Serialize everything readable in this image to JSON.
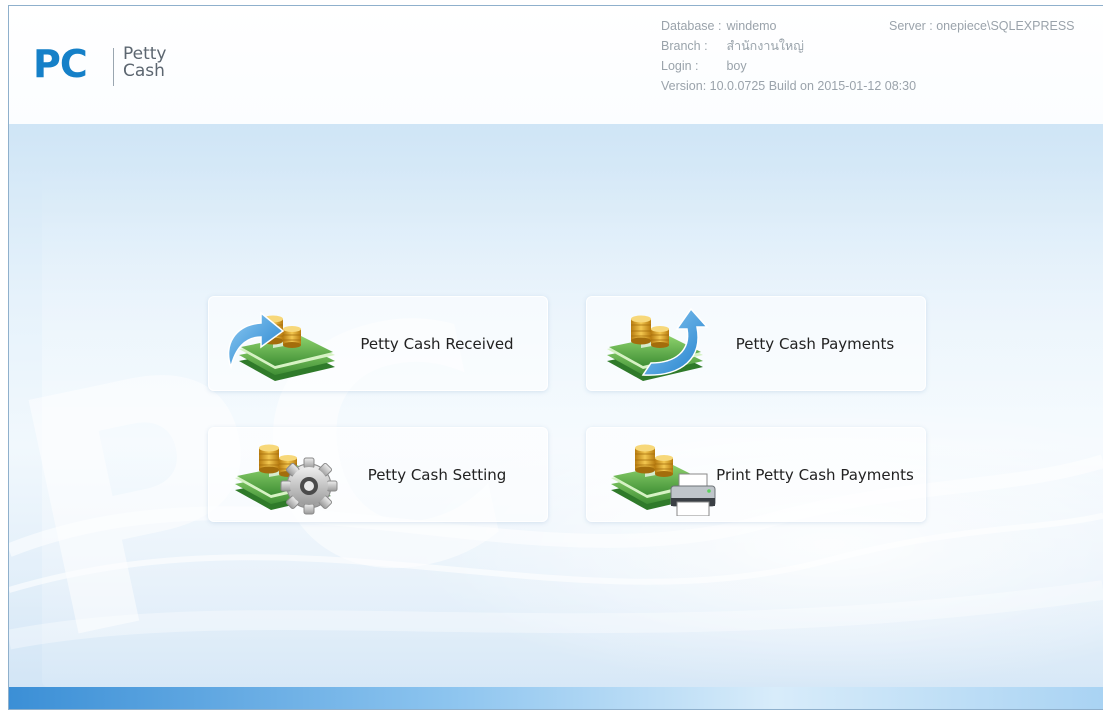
{
  "logo": {
    "mark": "PC",
    "line1": "Petty",
    "line2": "Cash"
  },
  "info": {
    "database_label": "Database :",
    "database_value": "windemo",
    "branch_label": "Branch :",
    "branch_value": "สำนักงานใหญ่",
    "login_label": "Login :",
    "login_value": "boy",
    "version_text": "Version: 10.0.0725  Build on 2015-01-12 08:30",
    "server_text": "Server : onepiece\\SQLEXPRESS"
  },
  "watermark": {
    "text": "PC"
  },
  "menu": {
    "received_label": "Petty Cash Received",
    "payments_label": "Petty Cash Payments",
    "setting_label": "Petty Cash Setting",
    "print_label": "Print Petty Cash Payments"
  },
  "icons": {
    "received": "money-received-icon",
    "payments": "money-payment-icon",
    "setting": "money-setting-icon",
    "print": "money-print-icon"
  },
  "colors": {
    "brand": "#1580c8",
    "info_text": "#9aa3ab",
    "arrow": "#3d9ad9",
    "money": "#5aa94a",
    "coin": "#d9a52a"
  }
}
